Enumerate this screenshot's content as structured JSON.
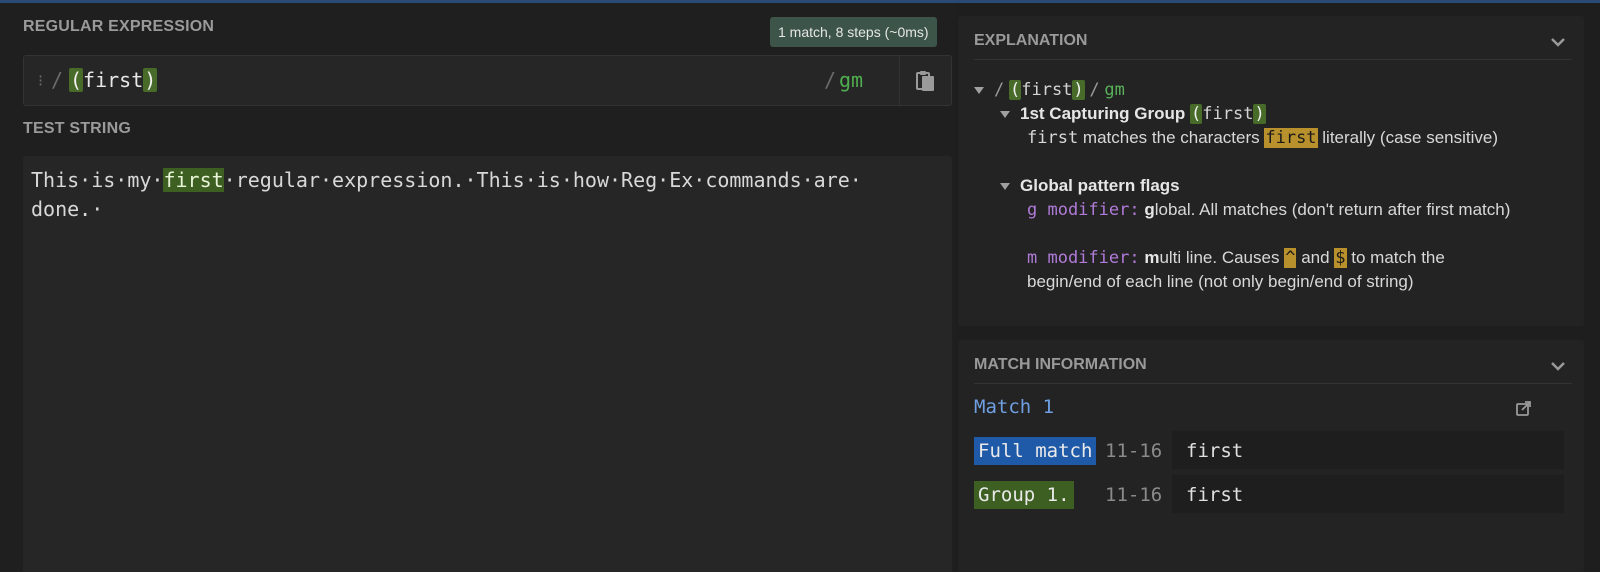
{
  "regex": {
    "section_title": "REGULAR EXPRESSION",
    "match_summary": "1 match, 8 steps (~0ms)",
    "drag_handle": "⁝",
    "open_delim": "/",
    "pattern_open_paren": "(",
    "pattern_body": "first",
    "pattern_close_paren": ")",
    "close_delim": "/",
    "flags": "gm"
  },
  "test": {
    "section_title": "TEST STRING",
    "text_before": "This·is·my·",
    "text_match": "first",
    "text_after": "·regular·expression.·This·is·how·Reg·Ex·commands·are·\ndone.·"
  },
  "explanation": {
    "title": "EXPLANATION",
    "root_slash_open": "/",
    "root_open_paren": "(",
    "root_body": "first",
    "root_close_paren": ")",
    "root_slash_close": "/",
    "root_flags": "gm",
    "group_title": "1st Capturing Group",
    "group_open_paren": "(",
    "group_body": "first",
    "group_close_paren": ")",
    "group_desc_token": "first",
    "group_desc_pre": "matches the characters",
    "group_desc_hl": "first",
    "group_desc_post": "literally (case sensitive)",
    "flags_title": "Global pattern flags",
    "g_mod": "g modifier:",
    "g_bold": "g",
    "g_rest": "lobal. All matches (don't return after first match)",
    "m_mod": "m modifier:",
    "m_bold": "m",
    "m_pre": "ulti line. Causes",
    "m_caret": "^",
    "m_and": "and",
    "m_dollar": "$",
    "m_post": "to match the begin/end of each line (not only begin/end of string)"
  },
  "match_info": {
    "title": "MATCH INFORMATION",
    "match_label": "Match 1",
    "rows": [
      {
        "label": "Full match",
        "range": "11-16",
        "value": "first"
      },
      {
        "label": "Group 1.",
        "range": "11-16",
        "value": "first"
      }
    ]
  },
  "colors": {
    "full_match_bg": "#1f5aa8",
    "group_bg": "#3d5f22",
    "badge_bg": "#3c5548"
  }
}
